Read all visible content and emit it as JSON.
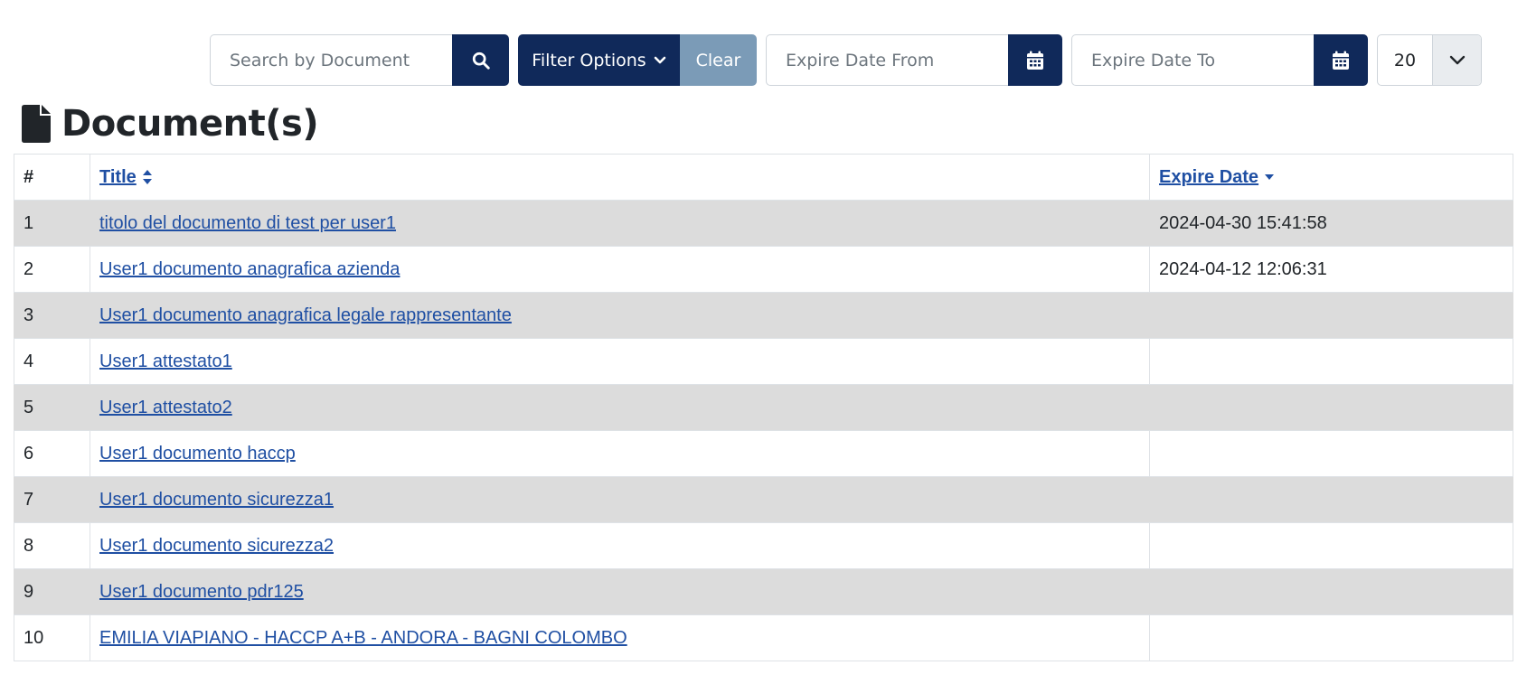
{
  "toolbar": {
    "search_placeholder": "Search by Document",
    "filter_label": "Filter Options",
    "clear_label": "Clear",
    "date_from_placeholder": "Expire Date From",
    "date_to_placeholder": "Expire Date To",
    "page_size": "20",
    "icons": {
      "search": "search-icon",
      "filter_caret": "chevron-down-icon",
      "calendar": "calendar-icon",
      "page_size_caret": "chevron-down-icon"
    }
  },
  "page": {
    "title": "Document(s)",
    "title_icon": "file-icon"
  },
  "table": {
    "headers": {
      "num": "#",
      "title": "Title",
      "expire": "Expire Date"
    },
    "rows": [
      {
        "num": "1",
        "title": "titolo del documento di test per user1",
        "expire": "2024-04-30 15:41:58"
      },
      {
        "num": "2",
        "title": "User1 documento anagrafica azienda",
        "expire": "2024-04-12 12:06:31"
      },
      {
        "num": "3",
        "title": "User1 documento anagrafica legale rappresentante",
        "expire": ""
      },
      {
        "num": "4",
        "title": "User1 attestato1",
        "expire": ""
      },
      {
        "num": "5",
        "title": "User1 attestato2",
        "expire": ""
      },
      {
        "num": "6",
        "title": "User1 documento haccp",
        "expire": ""
      },
      {
        "num": "7",
        "title": "User1 documento sicurezza1",
        "expire": ""
      },
      {
        "num": "8",
        "title": "User1 documento sicurezza2",
        "expire": ""
      },
      {
        "num": "9",
        "title": "User1 documento pdr125",
        "expire": ""
      },
      {
        "num": "10",
        "title": "EMILIA VIAPIANO - HACCP A+B - ANDORA - BAGNI COLOMBO",
        "expire": ""
      }
    ]
  },
  "colors": {
    "primary": "#10295a",
    "clear": "#7b9bb7",
    "link": "#1f4fa3",
    "stripe": "#dcdcdc"
  }
}
